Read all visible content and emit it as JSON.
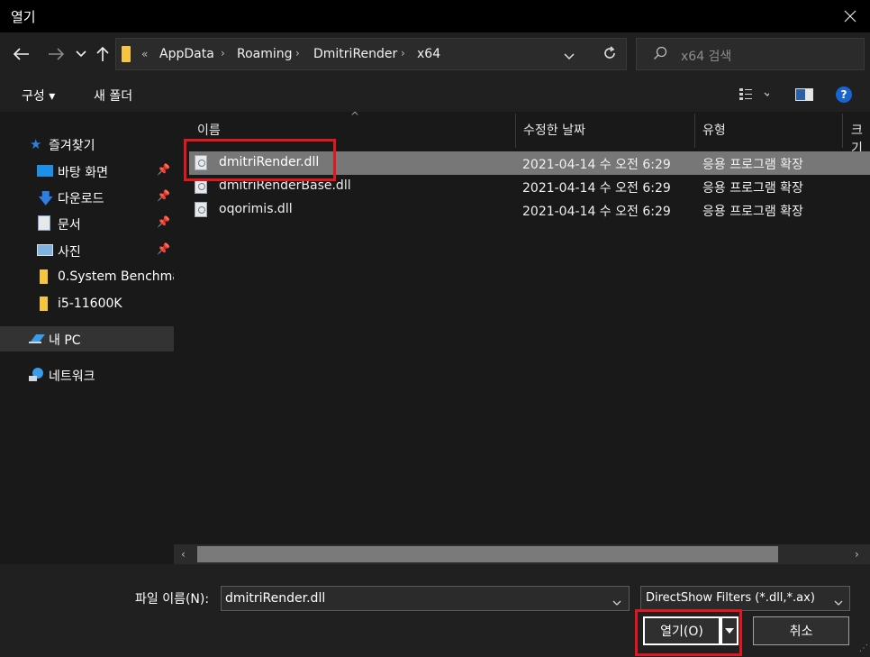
{
  "window": {
    "title": "열기"
  },
  "nav": {
    "breadcrumb_prefix": "«",
    "breadcrumbs": [
      "AppData",
      "Roaming",
      "DmitriRender",
      "x64"
    ],
    "search_placeholder": "x64 검색"
  },
  "toolbar": {
    "organize_label": "구성 ▾",
    "new_folder_label": "새 폴더"
  },
  "sidebar": {
    "quick_access": "즐겨찾기",
    "items": [
      {
        "label": "바탕 화면",
        "icon": "desktop-icon",
        "pinned": true
      },
      {
        "label": "다운로드",
        "icon": "download-icon",
        "pinned": true
      },
      {
        "label": "문서",
        "icon": "document-icon",
        "pinned": true
      },
      {
        "label": "사진",
        "icon": "picture-icon",
        "pinned": true
      },
      {
        "label": "0.System Benchmark",
        "icon": "folder-icon",
        "pinned": false
      },
      {
        "label": "i5-11600K",
        "icon": "folder-icon",
        "pinned": false
      }
    ],
    "this_pc": "내 PC",
    "network": "네트워크"
  },
  "columns": {
    "name": "이름",
    "date": "수정한 날짜",
    "type": "유형",
    "size": "크기"
  },
  "files": [
    {
      "name": "dmitriRender.dll",
      "date": "2021-04-14 수 오전 6:29",
      "type": "응용 프로그램 확장",
      "selected": true
    },
    {
      "name": "dmitriRenderBase.dll",
      "date": "2021-04-14 수 오전 6:29",
      "type": "응용 프로그램 확장",
      "selected": false
    },
    {
      "name": "oqorimis.dll",
      "date": "2021-04-14 수 오전 6:29",
      "type": "응용 프로그램 확장",
      "selected": false
    }
  ],
  "footer": {
    "filename_label": "파일 이름(N):",
    "filename_value": "dmitriRender.dll",
    "filter_value": "DirectShow Filters (*.dll,*.ax)",
    "open_label": "열기(O)",
    "cancel_label": "취소"
  },
  "colors": {
    "window_bg": "#191919",
    "titlebar": "#000000",
    "selection": "#777777",
    "highlight_box": "#e0171f",
    "folder": "#f5c542"
  }
}
